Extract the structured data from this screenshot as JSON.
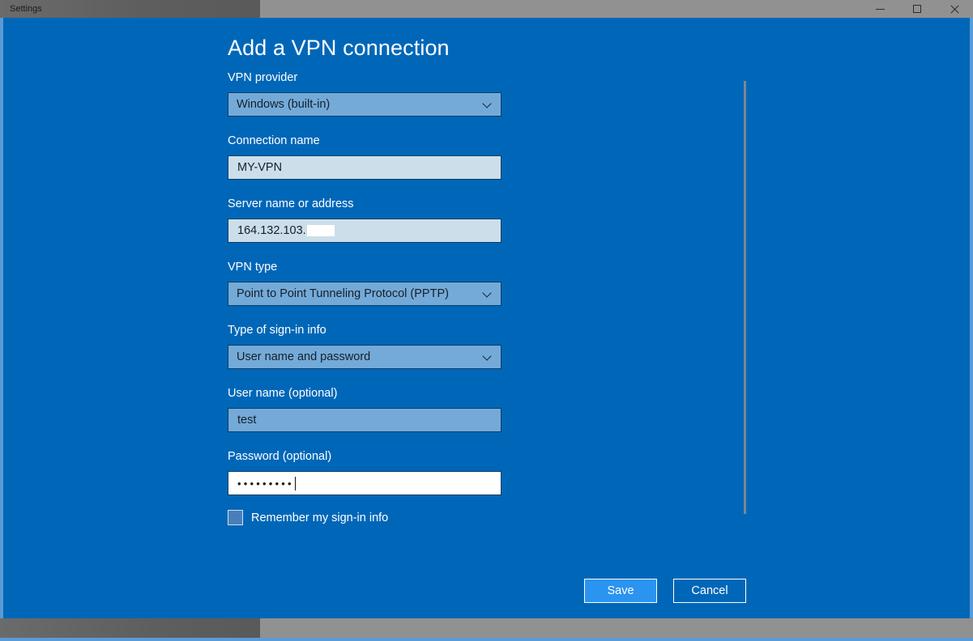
{
  "window": {
    "title": "Settings",
    "controls": {
      "minimize": "minimize",
      "maximize": "maximize",
      "close": "close"
    }
  },
  "page": {
    "title": "Add a VPN connection"
  },
  "form": {
    "fields": [
      {
        "label": "VPN provider",
        "type": "combobox",
        "value": "Windows (built-in)"
      },
      {
        "label": "Connection name",
        "type": "textbox",
        "value": "MY-VPN",
        "placeholder": ""
      },
      {
        "label": "Server name or address",
        "type": "textbox",
        "value": "164.132.103.",
        "redacted": true,
        "placeholder": ""
      },
      {
        "label": "VPN type",
        "type": "combobox",
        "value": "Point to Point Tunneling Protocol (PPTP)"
      },
      {
        "label": "Type of sign-in info",
        "type": "combobox",
        "value": "User name and password"
      },
      {
        "label": "User name (optional)",
        "type": "textbox",
        "value": "test",
        "placeholder": ""
      },
      {
        "label": "Password (optional)",
        "type": "password",
        "value": "•••••••••",
        "placeholder": ""
      }
    ],
    "remember_checkbox": {
      "label": "Remember my sign-in info",
      "checked": false
    }
  },
  "actions": {
    "save_label": "Save",
    "cancel_label": "Cancel"
  },
  "colors": {
    "accent_background": "#0067b8",
    "primary_button": "#2b93f0",
    "field_fill": "#ccdeea",
    "field_tinted": "#74aad8",
    "field_border": "#0a3d63",
    "titlebar": "#919191"
  }
}
